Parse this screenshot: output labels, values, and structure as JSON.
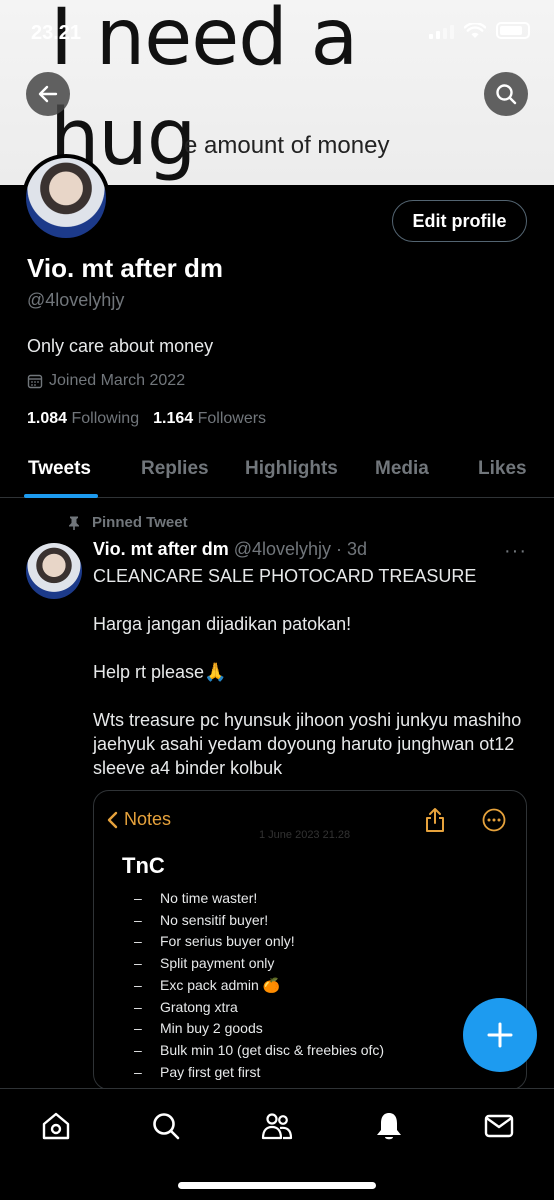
{
  "status_bar": {
    "time": "23.21"
  },
  "banner": {
    "line1": "I need a",
    "line2": "hug",
    "line3": "e amount of money"
  },
  "profile": {
    "display_name": "Vio. mt after dm",
    "handle": "@4lovelyhjy",
    "bio": "Only care about money",
    "joined": "Joined March 2022",
    "following_count": "1.084",
    "following_label": "Following",
    "followers_count": "1.164",
    "followers_label": "Followers",
    "edit_label": "Edit profile"
  },
  "tabs": [
    {
      "label": "Tweets",
      "active": true
    },
    {
      "label": "Replies"
    },
    {
      "label": "Highlights"
    },
    {
      "label": "Media"
    },
    {
      "label": "Likes"
    }
  ],
  "tweet": {
    "pinned_label": "Pinned Tweet",
    "name": "Vio. mt after dm",
    "meta": "@4lovelyhjy · 3d",
    "more": "···",
    "paragraphs": [
      "CLEANCARE SALE PHOTOCARD TREASURE",
      "Harga jangan dijadikan patokan!",
      "Help rt please🙏",
      "Wts treasure pc hyunsuk jihoon yoshi junkyu mashiho jaehyuk asahi yedam doyoung haruto junghwan ot12 sleeve a4 binder kolbuk"
    ],
    "card": {
      "back_label": "Notes",
      "date": "1 June 2023 21.28",
      "heading": "TnC",
      "rules": [
        "No time waster!",
        "No sensitif buyer!",
        "For serius buyer only!",
        "Split payment only",
        "Exc pack admin 🍊",
        "Gratong xtra",
        "Min buy 2 goods",
        "Bulk min 10 (get disc & freebies ofc)",
        "Pay first get first"
      ]
    }
  },
  "colors": {
    "accent": "#1d9bf0",
    "notes_accent": "#e6a23c",
    "muted": "#71767b"
  }
}
